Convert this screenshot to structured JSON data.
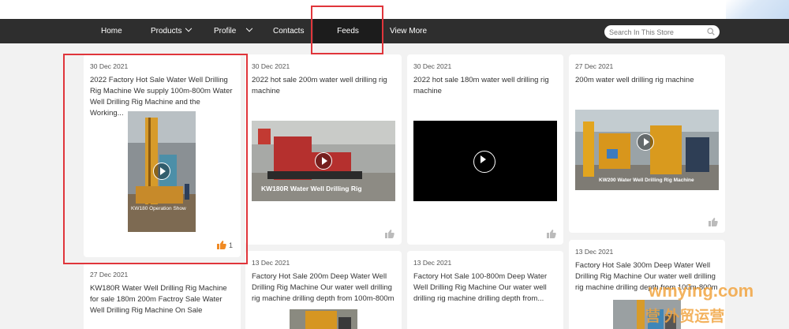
{
  "nav": {
    "items": [
      {
        "label": "Home",
        "dropdown": false
      },
      {
        "label": "Products",
        "dropdown": true
      },
      {
        "label": "Profile",
        "dropdown": true
      },
      {
        "label": "Contacts",
        "dropdown": false
      },
      {
        "label": "Feeds",
        "dropdown": false,
        "active": true
      },
      {
        "label": "View More",
        "dropdown": false
      }
    ],
    "search_placeholder": "Search In This Store"
  },
  "feeds": [
    {
      "date": "30 Dec 2021",
      "title": "2022 Factory Hot Sale Water Well Drilling Rig Machine We supply 100m-800m Water Well Drilling Rig Machine and the Working...",
      "video_caption": "KW180 Operation Show",
      "likes": "1"
    },
    {
      "date": "30 Dec 2021",
      "title": "2022 hot sale 200m water well drilling rig machine",
      "video_caption": "KW180R Water Well Drilling Rig",
      "likes": ""
    },
    {
      "date": "30 Dec 2021",
      "title": "2022 hot sale 180m water well drilling rig machine",
      "video_caption": "",
      "likes": ""
    },
    {
      "date": "27 Dec 2021",
      "title": "200m water well drilling rig machine",
      "video_caption": "KW200 Water Well Drilling Rig Machine",
      "likes": ""
    },
    {
      "date": "27 Dec 2021",
      "title": "KW180R Water Well Drilling Rig Machine for sale 180m 200m Factroy Sale Water Well Drilling Rig Machine On Sale"
    },
    {
      "date": "13 Dec 2021",
      "title": "Factory Hot Sale 200m Deep Water Well Drilling Rig Machine Our water well drilling rig machine drilling depth from 100m-800m"
    },
    {
      "date": "13 Dec 2021",
      "title": "Factory Hot Sale 100-800m Deep Water Well Drilling Rig Machine Our water well drilling rig machine drilling depth from..."
    },
    {
      "date": "13 Dec 2021",
      "title": "Factory Hot Sale 300m Deep Water Well Drilling Rig Machine Our water well drilling rig machine drilling depth from 100m-800m"
    }
  ],
  "watermark": {
    "line1": "wmying.com",
    "line2": "营 外贸运营"
  },
  "colors": {
    "nav_bg": "#2e2e2e",
    "highlight": "#e0353b",
    "like_active": "#f08a24",
    "like_inactive": "#bbbbbb"
  }
}
